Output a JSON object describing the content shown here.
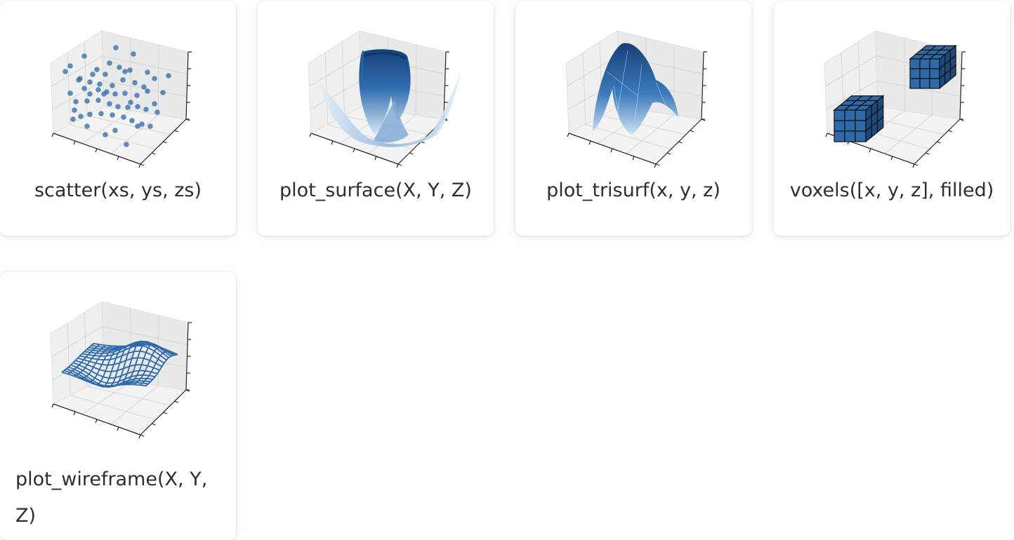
{
  "gallery": {
    "items": [
      {
        "id": "scatter",
        "caption": "scatter(xs, ys, zs)",
        "thumbnail": "3d-scatter-plot"
      },
      {
        "id": "surface",
        "caption": "plot_surface(X, Y, Z)",
        "thumbnail": "3d-surface-plot"
      },
      {
        "id": "trisurf",
        "caption": "plot_trisurf(x, y, z)",
        "thumbnail": "3d-trisurf-plot"
      },
      {
        "id": "voxels",
        "caption": "voxels([x, y, z], filled)",
        "thumbnail": "3d-voxels-plot"
      },
      {
        "id": "wireframe",
        "caption": "plot_wireframe(X, Y, Z)",
        "thumbnail": "3d-wireframe-plot"
      }
    ]
  },
  "colors": {
    "primary_blue": "#2e6aa8",
    "light_blue": "#c9ddf0",
    "dark_blue": "#143f7a",
    "pane": "#efefef",
    "text": "#2e2e2e"
  }
}
